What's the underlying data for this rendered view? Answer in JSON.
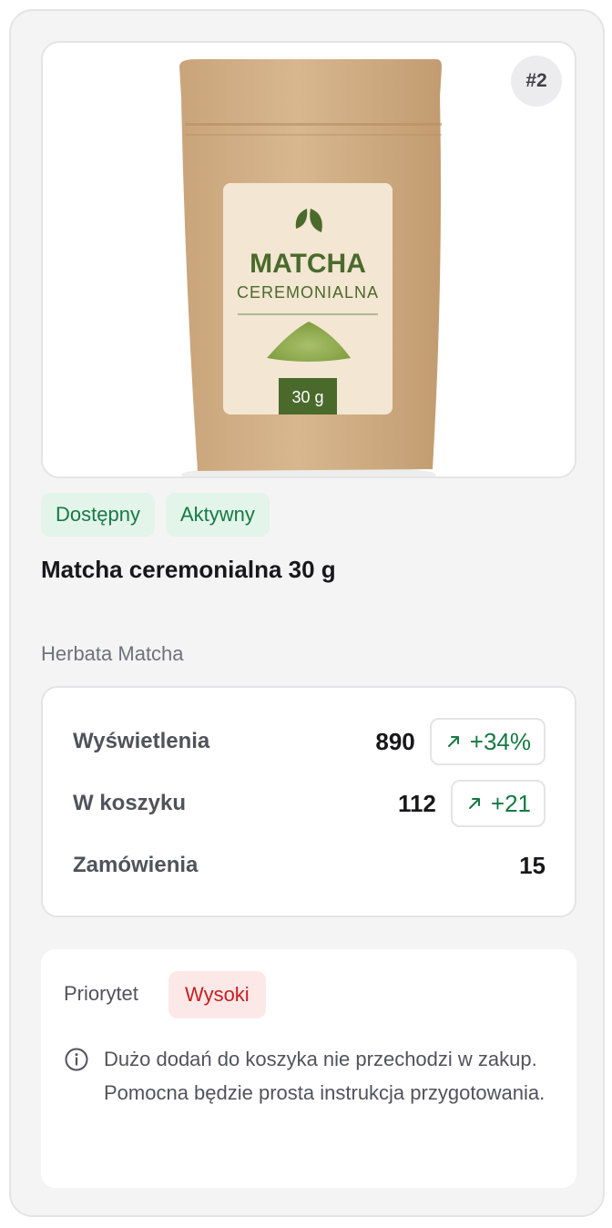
{
  "product": {
    "rank": "#2",
    "title": "Matcha ceremonialna 30 g",
    "category": "Herbata Matcha",
    "package": {
      "brand": "MATCHA",
      "subtitle": "CEREMONIALNA",
      "weight": "30 g"
    }
  },
  "badges": [
    {
      "label": "Dostępny"
    },
    {
      "label": "Aktywny"
    }
  ],
  "stats": [
    {
      "label": "Wyświetlenia",
      "value": "890",
      "delta": "+34%",
      "trend_icon": "arrow-up-right-icon"
    },
    {
      "label": "W koszyku",
      "value": "112",
      "delta": "+21",
      "trend_icon": "arrow-up-right-icon"
    },
    {
      "label": "Zamówienia",
      "value": "15"
    }
  ],
  "priority": {
    "label": "Priorytet",
    "level": "Wysoki",
    "note": "Dużo dodań do koszyka nie przechodzi w zakup. Pomocna będzie prosta instrukcja przygotowania.",
    "icon": "info-icon"
  },
  "colors": {
    "positive": "#157a43",
    "positive_bg": "#e3f4ea",
    "danger": "#c81e1e",
    "danger_bg": "#fde8e8",
    "label_green": "#4a6a2c"
  }
}
